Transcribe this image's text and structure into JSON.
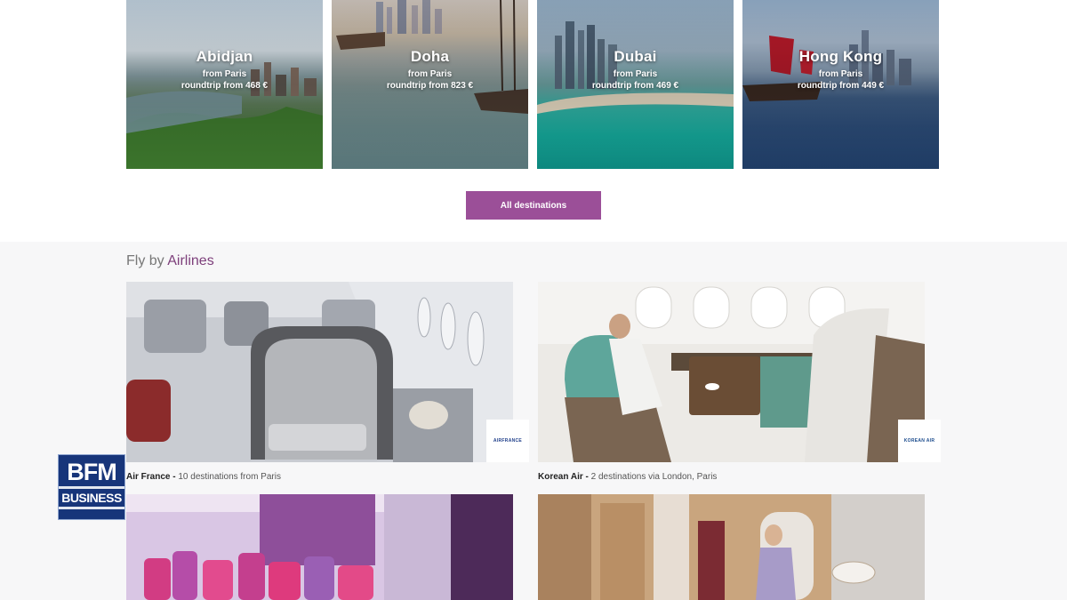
{
  "destinations": [
    {
      "city": "Abidjan",
      "from": "from Paris",
      "price": "roundtrip from 468 €"
    },
    {
      "city": "Doha",
      "from": "from Paris",
      "price": "roundtrip from 823 €"
    },
    {
      "city": "Dubai",
      "from": "from Paris",
      "price": "roundtrip from 469 €"
    },
    {
      "city": "Hong Kong",
      "from": "from Paris",
      "price": "roundtrip from 449 €"
    }
  ],
  "all_destinations_label": "All destinations",
  "airlines_section": {
    "title_prefix": "Fly by ",
    "title_accent": "Airlines"
  },
  "airlines": [
    {
      "name": "Air France -",
      "detail": "10 destinations from Paris",
      "logo": "AIRFRANCE"
    },
    {
      "name": "Korean Air -",
      "detail": "2 destinations via London, Paris",
      "logo": "KOREAN AIR"
    }
  ],
  "broadcaster": {
    "line1": "BFM",
    "line2": "BUSINESS"
  },
  "colors": {
    "accent": "#9b4f98",
    "title_accent": "#7d3f7b",
    "section_bg": "#f7f7f8",
    "bfm_blue": "#17357a"
  }
}
